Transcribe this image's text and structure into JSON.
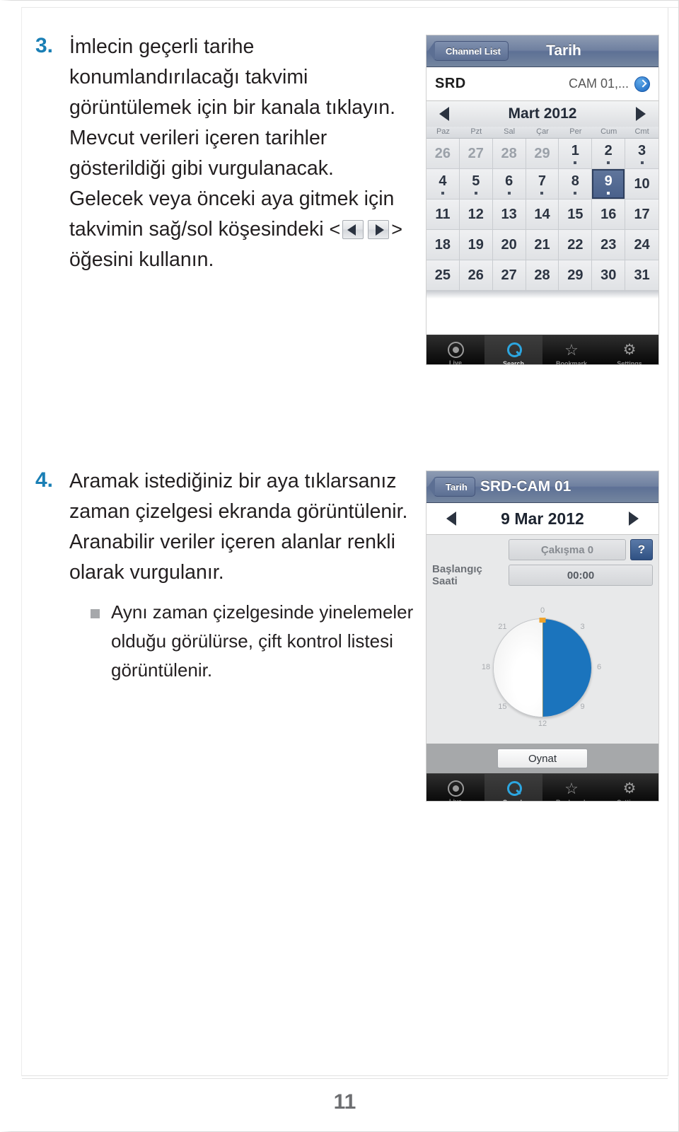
{
  "document": {
    "page_number": "11"
  },
  "steps": [
    {
      "number": "3.",
      "paragraphs": [
        "İmlecin geçerli tarihe konumlandırılacağı takvimi görüntülemek için bir kanala tıklayın.",
        "Mevcut verileri içeren tarihler gösterildiği gibi vurgulanacak."
      ],
      "inline_paragraph": {
        "before": "Gelecek veya önceki aya gitmek için takvimin sağ/sol köşesindeki ",
        "open_angle": "<",
        "close_angle": ">",
        "after": " öğesini kullanın.",
        "icons": [
          "prev-arrow-button-icon",
          "next-arrow-button-icon"
        ]
      }
    },
    {
      "number": "4.",
      "paragraphs": [
        "Aramak istediğiniz bir aya tıklarsanız zaman çizelgesi ekranda görüntülenir.",
        "Aranabilir veriler içeren alanlar renkli olarak vurgulanır."
      ],
      "bullets": [
        "Aynı zaman çizelgesinde yinelemeler olduğu görülürse, çift kontrol listesi görüntülenir."
      ]
    }
  ],
  "calendar_screenshot": {
    "navbar": {
      "back_label": "Channel List",
      "title": "Tarih"
    },
    "device_row": {
      "device": "SRD",
      "channels": "CAM 01,...",
      "disclosure_icon": "chevron-right-circle-icon"
    },
    "month_bar": {
      "prev_icon": "arrow-left-icon",
      "title": "Mart 2012",
      "next_icon": "arrow-right-icon"
    },
    "weekdays": [
      "Paz",
      "Pzt",
      "Sal",
      "Çar",
      "Per",
      "Cum",
      "Cmt"
    ],
    "days": [
      {
        "d": "26",
        "muted": true,
        "data": false,
        "selected": false
      },
      {
        "d": "27",
        "muted": true,
        "data": false,
        "selected": false
      },
      {
        "d": "28",
        "muted": true,
        "data": false,
        "selected": false
      },
      {
        "d": "29",
        "muted": true,
        "data": false,
        "selected": false
      },
      {
        "d": "1",
        "muted": false,
        "data": true,
        "selected": false
      },
      {
        "d": "2",
        "muted": false,
        "data": true,
        "selected": false
      },
      {
        "d": "3",
        "muted": false,
        "data": true,
        "selected": false
      },
      {
        "d": "4",
        "muted": false,
        "data": true,
        "selected": false
      },
      {
        "d": "5",
        "muted": false,
        "data": true,
        "selected": false
      },
      {
        "d": "6",
        "muted": false,
        "data": true,
        "selected": false
      },
      {
        "d": "7",
        "muted": false,
        "data": true,
        "selected": false
      },
      {
        "d": "8",
        "muted": false,
        "data": true,
        "selected": false
      },
      {
        "d": "9",
        "muted": false,
        "data": true,
        "selected": true
      },
      {
        "d": "10",
        "muted": false,
        "data": false,
        "selected": false
      },
      {
        "d": "11",
        "muted": false,
        "data": false,
        "selected": false
      },
      {
        "d": "12",
        "muted": false,
        "data": false,
        "selected": false
      },
      {
        "d": "13",
        "muted": false,
        "data": false,
        "selected": false
      },
      {
        "d": "14",
        "muted": false,
        "data": false,
        "selected": false
      },
      {
        "d": "15",
        "muted": false,
        "data": false,
        "selected": false
      },
      {
        "d": "16",
        "muted": false,
        "data": false,
        "selected": false
      },
      {
        "d": "17",
        "muted": false,
        "data": false,
        "selected": false
      },
      {
        "d": "18",
        "muted": false,
        "data": false,
        "selected": false
      },
      {
        "d": "19",
        "muted": false,
        "data": false,
        "selected": false
      },
      {
        "d": "20",
        "muted": false,
        "data": false,
        "selected": false
      },
      {
        "d": "21",
        "muted": false,
        "data": false,
        "selected": false
      },
      {
        "d": "22",
        "muted": false,
        "data": false,
        "selected": false
      },
      {
        "d": "23",
        "muted": false,
        "data": false,
        "selected": false
      },
      {
        "d": "24",
        "muted": false,
        "data": false,
        "selected": false
      },
      {
        "d": "25",
        "muted": false,
        "data": false,
        "selected": false
      },
      {
        "d": "26",
        "muted": false,
        "data": false,
        "selected": false
      },
      {
        "d": "27",
        "muted": false,
        "data": false,
        "selected": false
      },
      {
        "d": "28",
        "muted": false,
        "data": false,
        "selected": false
      },
      {
        "d": "29",
        "muted": false,
        "data": false,
        "selected": false
      },
      {
        "d": "30",
        "muted": false,
        "data": false,
        "selected": false
      },
      {
        "d": "31",
        "muted": false,
        "data": false,
        "selected": false
      }
    ],
    "tabbar": [
      {
        "label": "Live",
        "icon": "live-icon",
        "active": false
      },
      {
        "label": "Search",
        "icon": "search-icon",
        "active": true
      },
      {
        "label": "Bookmark",
        "icon": "star-icon",
        "active": false
      },
      {
        "label": "Settings",
        "icon": "gear-icon",
        "active": false
      }
    ]
  },
  "timeline_screenshot": {
    "navbar": {
      "back_label": "Tarih",
      "title": "SRD-CAM 01"
    },
    "date_bar": {
      "prev_icon": "arrow-left-icon",
      "date": "9 Mar 2012",
      "next_icon": "arrow-right-icon"
    },
    "controls": {
      "overlap_label": "Çakışma 0",
      "help_label": "?",
      "start_time_label": "Başlangıç Saati",
      "start_time_value": "00:00"
    },
    "clock": {
      "hour_labels": [
        "0",
        "3",
        "6",
        "9",
        "12",
        "15",
        "18",
        "21"
      ],
      "highlight_start_hour": 0,
      "highlight_end_hour": 12,
      "highlight_color": "#1b74bd",
      "marker_color": "#efa32b",
      "marker_hour": 0
    },
    "play_button": "Oynat",
    "tabbar": [
      {
        "label": "Live",
        "icon": "live-icon",
        "active": false
      },
      {
        "label": "Search",
        "icon": "search-icon",
        "active": true
      },
      {
        "label": "Bookmark",
        "icon": "star-icon",
        "active": false
      },
      {
        "label": "Settings",
        "icon": "gear-icon",
        "active": false
      }
    ]
  }
}
